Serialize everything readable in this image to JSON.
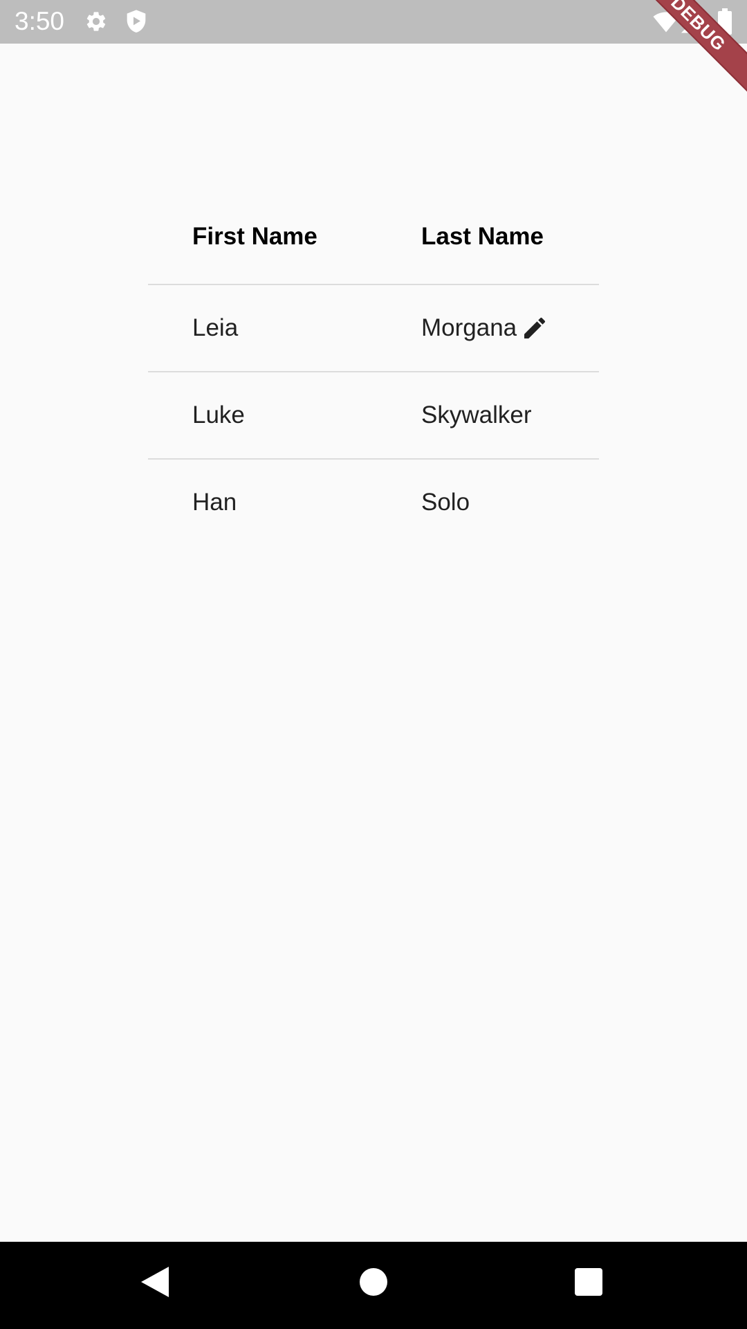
{
  "status_bar": {
    "time": "3:50",
    "icons": [
      "gear-icon",
      "shield-icon",
      "wifi-icon",
      "signal-icon",
      "battery-icon"
    ]
  },
  "debug_banner": {
    "label": "DEBUG",
    "color": "#a4424a"
  },
  "table": {
    "columns": [
      "First Name",
      "Last Name"
    ],
    "rows": [
      {
        "first": "Leia",
        "last": "Morgana",
        "editable_icon": "edit-icon"
      },
      {
        "first": "Luke",
        "last": "Skywalker"
      },
      {
        "first": "Han",
        "last": "Solo"
      }
    ]
  },
  "nav_bar": {
    "buttons": [
      "back-icon",
      "home-icon",
      "recents-icon"
    ]
  }
}
